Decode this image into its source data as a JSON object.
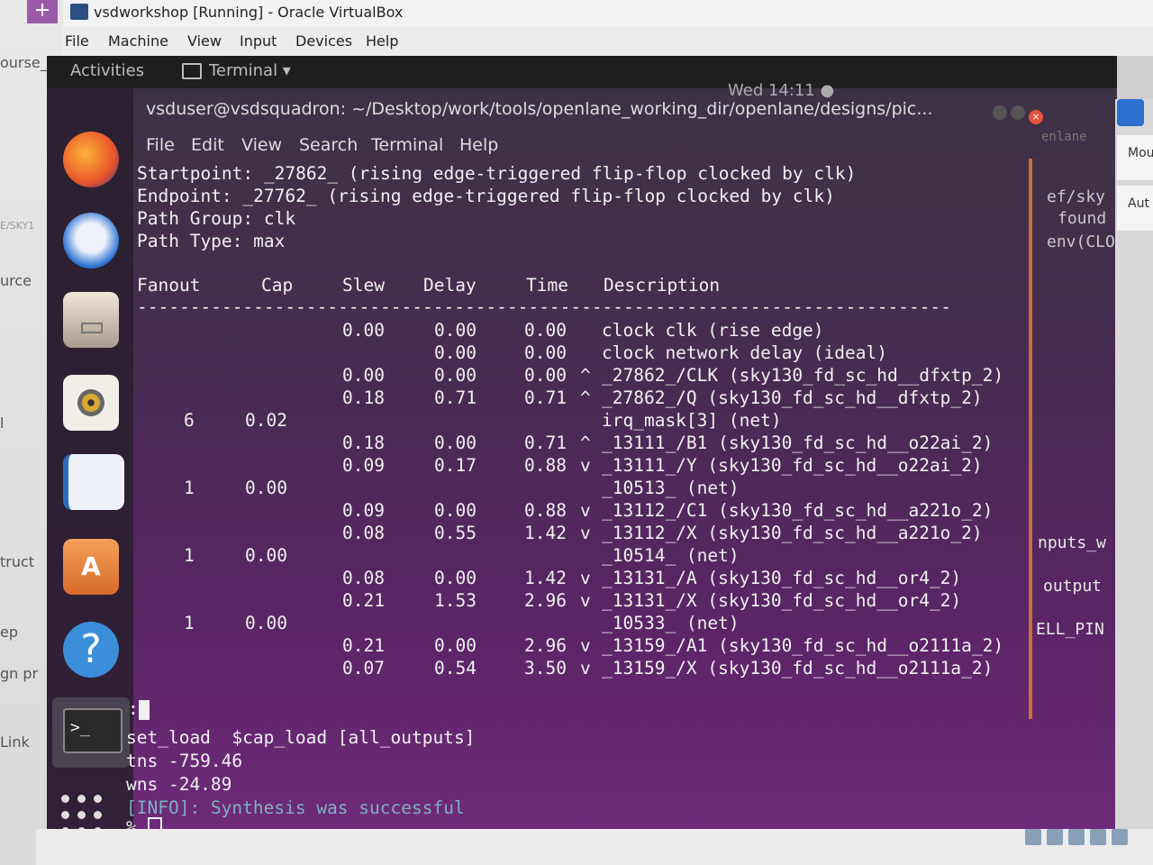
{
  "host": {
    "left_labels": [
      "ourse_",
      "E/SKY1",
      "urce",
      "l",
      "truct",
      "ep",
      "gn pr",
      "Link"
    ]
  },
  "vbox": {
    "title": "vsdworkshop [Running] - Oracle VirtualBox",
    "menu": [
      "File",
      "Machine",
      "View",
      "Input",
      "Devices",
      "Help"
    ]
  },
  "gnome": {
    "activities": "Activities",
    "app_menu": "Terminal ▾",
    "clock": "Wed 14:11 ●"
  },
  "dock": {
    "items": [
      "firefox-icon",
      "thunderbird-icon",
      "files-icon",
      "rhythmbox-icon",
      "writer-icon",
      "software-icon",
      "help-icon",
      "terminal-icon",
      "show-apps-icon"
    ],
    "terminal_glyph": ">_",
    "help_glyph": "?"
  },
  "terminal": {
    "title": "vsduser@vsdsquadron: ~/Desktop/work/tools/openlane_working_dir/openlane/designs/pic...",
    "menu": [
      "File",
      "Edit",
      "View",
      "Search",
      "Terminal",
      "Help"
    ],
    "header_lines": [
      "Startpoint: _27862_ (rising edge-triggered flip-flop clocked by clk)",
      "Endpoint: _27762_ (rising edge-triggered flip-flop clocked by clk)",
      "Path Group: clk",
      "Path Type: max"
    ],
    "columns": [
      "Fanout",
      "Cap",
      "Slew",
      "Delay",
      "Time",
      "Description"
    ],
    "separator": "-----------------------------------------------------------------------------",
    "rows": [
      {
        "fanout": "",
        "cap": "",
        "slew": "0.00",
        "delay": "0.00",
        "time": "0.00",
        "dir": "",
        "desc": "clock clk (rise edge)"
      },
      {
        "fanout": "",
        "cap": "",
        "slew": "",
        "delay": "0.00",
        "time": "0.00",
        "dir": "",
        "desc": "clock network delay (ideal)"
      },
      {
        "fanout": "",
        "cap": "",
        "slew": "0.00",
        "delay": "0.00",
        "time": "0.00",
        "dir": "^",
        "desc": "_27862_/CLK (sky130_fd_sc_hd__dfxtp_2)"
      },
      {
        "fanout": "",
        "cap": "",
        "slew": "0.18",
        "delay": "0.71",
        "time": "0.71",
        "dir": "^",
        "desc": "_27862_/Q (sky130_fd_sc_hd__dfxtp_2)"
      },
      {
        "fanout": "6",
        "cap": "0.02",
        "slew": "",
        "delay": "",
        "time": "",
        "dir": "",
        "desc": "irq_mask[3] (net)"
      },
      {
        "fanout": "",
        "cap": "",
        "slew": "0.18",
        "delay": "0.00",
        "time": "0.71",
        "dir": "^",
        "desc": "_13111_/B1 (sky130_fd_sc_hd__o22ai_2)"
      },
      {
        "fanout": "",
        "cap": "",
        "slew": "0.09",
        "delay": "0.17",
        "time": "0.88",
        "dir": "v",
        "desc": "_13111_/Y (sky130_fd_sc_hd__o22ai_2)"
      },
      {
        "fanout": "1",
        "cap": "0.00",
        "slew": "",
        "delay": "",
        "time": "",
        "dir": "",
        "desc": "_10513_ (net)"
      },
      {
        "fanout": "",
        "cap": "",
        "slew": "0.09",
        "delay": "0.00",
        "time": "0.88",
        "dir": "v",
        "desc": "_13112_/C1 (sky130_fd_sc_hd__a221o_2)"
      },
      {
        "fanout": "",
        "cap": "",
        "slew": "0.08",
        "delay": "0.55",
        "time": "1.42",
        "dir": "v",
        "desc": "_13112_/X (sky130_fd_sc_hd__a221o_2)"
      },
      {
        "fanout": "1",
        "cap": "0.00",
        "slew": "",
        "delay": "",
        "time": "",
        "dir": "",
        "desc": "_10514_ (net)"
      },
      {
        "fanout": "",
        "cap": "",
        "slew": "0.08",
        "delay": "0.00",
        "time": "1.42",
        "dir": "v",
        "desc": "_13131_/A (sky130_fd_sc_hd__or4_2)"
      },
      {
        "fanout": "",
        "cap": "",
        "slew": "0.21",
        "delay": "1.53",
        "time": "2.96",
        "dir": "v",
        "desc": "_13131_/X (sky130_fd_sc_hd__or4_2)"
      },
      {
        "fanout": "1",
        "cap": "0.00",
        "slew": "",
        "delay": "",
        "time": "",
        "dir": "",
        "desc": "_10533_ (net)"
      },
      {
        "fanout": "",
        "cap": "",
        "slew": "0.21",
        "delay": "0.00",
        "time": "2.96",
        "dir": "v",
        "desc": "_13159_/A1 (sky130_fd_sc_hd__o2111a_2)"
      },
      {
        "fanout": "",
        "cap": "",
        "slew": "0.07",
        "delay": "0.54",
        "time": "3.50",
        "dir": "v",
        "desc": "_13159_/X (sky130_fd_sc_hd__o2111a_2)"
      }
    ],
    "pager_prompt": ":",
    "tail_lines": [
      "set_load  $cap_load [all_outputs]",
      "tns -759.46",
      "wns -24.89"
    ],
    "info_line": "[INFO]: Synthesis was successful",
    "prompt": "%"
  },
  "right_panel": {
    "texts": [
      "enlane",
      "ef/sky",
      "found",
      "env(CLOCK_",
      "nputs_w",
      "output",
      "ELL_PIN"
    ],
    "cards": [
      "Mou",
      "Aut"
    ]
  },
  "colors": {
    "info": "#7fb0c0",
    "scrollbar": "#c8703a",
    "terminal_bg_bottom": "#6e2a7a"
  }
}
